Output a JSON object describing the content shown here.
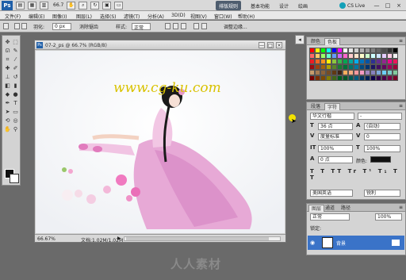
{
  "app": {
    "logo": "Ps",
    "zoom": "66.7",
    "workspaces": [
      "排版规则",
      "基本功能",
      "设计",
      "绘画"
    ],
    "active_workspace_index": 0,
    "cs_live": "CS Live",
    "window_controls": [
      "—",
      "□",
      "×"
    ]
  },
  "menubar": {
    "items": [
      "文件(F)",
      "编辑(E)",
      "图像(I)",
      "图层(L)",
      "选择(S)",
      "滤镜(T)",
      "分析(A)",
      "3D(D)",
      "视图(V)",
      "窗口(W)",
      "帮助(H)"
    ]
  },
  "options": {
    "feather_label": "羽化:",
    "feather_value": "0 px",
    "antialias_label": "消除锯齿",
    "style_label": "样式:",
    "style_value": "正常",
    "refine_label": "调整边缘..."
  },
  "document": {
    "title": "07-2_ps @ 66.7% (RGB/8)",
    "zoom_status": "66.67%",
    "doc_info": "文档:1.02M/1.02M",
    "arrow": "▶"
  },
  "colors": {
    "accent": "#3a73c8",
    "foreground": "#111111",
    "background": "#ffffff",
    "watermark_yellow": "#d9c200"
  },
  "swatches_panel": {
    "tabs": [
      "颜色",
      "色板"
    ],
    "active_tab": 1,
    "swatches": [
      "#ff0000",
      "#ffff00",
      "#00ff00",
      "#00ffff",
      "#0000ff",
      "#ff00ff",
      "#ffffff",
      "#e6e6e6",
      "#cccccc",
      "#b3b3b3",
      "#999999",
      "#808080",
      "#666666",
      "#4d4d4d",
      "#333333",
      "#000000",
      "#ff6666",
      "#ffcc66",
      "#99ff66",
      "#66ffcc",
      "#6699ff",
      "#cc66ff",
      "#ff66cc",
      "#ffcccc",
      "#ffe5cc",
      "#ffffcc",
      "#ccffcc",
      "#ccffff",
      "#cce5ff",
      "#e5ccff",
      "#ffcce5",
      "#f2f2f2",
      "#ed1c24",
      "#f26522",
      "#f7941d",
      "#fff200",
      "#8dc63f",
      "#39b54a",
      "#00a651",
      "#00a99d",
      "#00aeef",
      "#0072bc",
      "#0054a6",
      "#2e3192",
      "#662d91",
      "#92278f",
      "#ec008c",
      "#ed145b",
      "#9e0b0f",
      "#a0410d",
      "#a36209",
      "#aba000",
      "#598527",
      "#197b30",
      "#007236",
      "#00746b",
      "#0076a3",
      "#004a80",
      "#003471",
      "#1b1464",
      "#440e62",
      "#630460",
      "#9e005d",
      "#9e0039",
      "#c69c6d",
      "#a67c52",
      "#8c6239",
      "#754c24",
      "#603913",
      "#3c2415",
      "#fbaf5d",
      "#f9ad81",
      "#f6989d",
      "#f49ac1",
      "#a186be",
      "#8781bd",
      "#7da7d9",
      "#6dcff6",
      "#7accc8",
      "#82ca9c",
      "#790000",
      "#7b2e00",
      "#7d4900",
      "#827b00",
      "#406618",
      "#005e20",
      "#005826",
      "#005952",
      "#005b7f",
      "#003663",
      "#002157",
      "#0d004c",
      "#32004b",
      "#4b0049",
      "#7b0046",
      "#7a0026"
    ]
  },
  "char_panel": {
    "tabs": [
      "段落",
      "字符"
    ],
    "active_tab": 1,
    "font_family": "华文行楷",
    "font_style": "-",
    "font_size": "36 点",
    "leading": "(自动)",
    "kerning": "度量标准",
    "tracking": "0",
    "vscale": "100%",
    "hscale": "100%",
    "baseline": "0 点",
    "color_label": "颜色:",
    "language": "美国英语",
    "aa": "锐利"
  },
  "layers_panel": {
    "tabs": [
      "图层",
      "通道",
      "路径"
    ],
    "active_tab": 0,
    "blend_mode": "正常",
    "opacity": "100%",
    "layer_name": "背景",
    "lock_label": "锁定:"
  },
  "overlay": {
    "watermark_url": "www.cg-ku.com",
    "watermark_bottom": "人人素材"
  }
}
